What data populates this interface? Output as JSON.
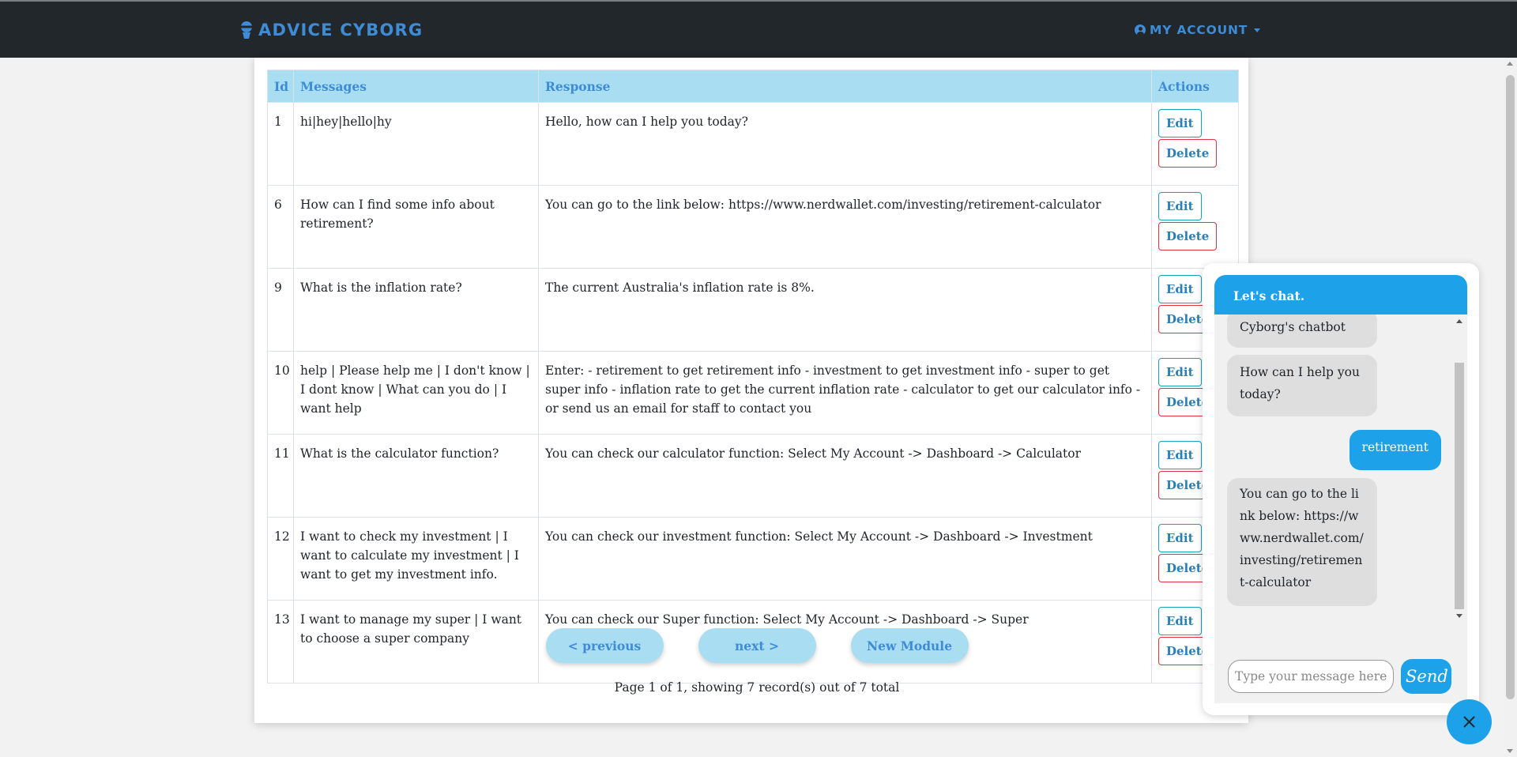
{
  "navbar": {
    "brand": "ADVICE CYBORG",
    "account_label": "MY ACCOUNT"
  },
  "table": {
    "headers": [
      "Id",
      "Messages",
      "Response",
      "Actions"
    ],
    "rows": [
      {
        "id": "1",
        "message": "hi|hey|hello|hy",
        "response": "Hello, how can I help you today?"
      },
      {
        "id": "6",
        "message": "How can I find some info about retirement?",
        "response": "You can go to the link below: https://www.nerdwallet.com/investing/retirement-calculator"
      },
      {
        "id": "9",
        "message": "What is the inflation rate?",
        "response": "The current Australia's inflation rate is 8%."
      },
      {
        "id": "10",
        "message": "help | Please help me | I don't know | I dont know | What can you do | I want help",
        "response": "Enter: - retirement to get retirement info - investment to get investment info - super to get super info - inflation rate to get the current inflation rate - calculator to get our calculator info - or send us an email for staff to contact you"
      },
      {
        "id": "11",
        "message": "What is the calculator function?",
        "response": "You can check our calculator function: Select My Account -> Dashboard -> Calculator"
      },
      {
        "id": "12",
        "message": "I want to check my investment | I want to calculate my investment | I want to get my investment info.",
        "response": "You can check our investment function: Select My Account -> Dashboard -> Investment"
      },
      {
        "id": "13",
        "message": "I want to manage my super | I want to choose a super company",
        "response": "You can check our Super function: Select My Account -> Dashboard -> Super"
      }
    ],
    "edit_label": "Edit",
    "delete_label": "Delete"
  },
  "pager": {
    "previous_label": "< previous",
    "next_label": "next >",
    "new_module_label": "New Module",
    "info": "Page 1 of 1, showing 7 record(s) out of 7 total"
  },
  "chat": {
    "header": "Let's chat.",
    "messages": [
      {
        "from": "bot",
        "text": "Cyborg's chatbot"
      },
      {
        "from": "bot",
        "text": "How can I help you today?"
      },
      {
        "from": "user",
        "text": "retirement"
      },
      {
        "from": "bot",
        "text": "You can go to the link below: https://www.nerdwallet.com/investing/retirement-calculator"
      }
    ],
    "input_placeholder": "Type your message here...",
    "send_label": "Send"
  },
  "colors": {
    "navbar_bg": "#22272c",
    "brand_blue": "#3e8bd6",
    "table_header_bg": "#a9def2",
    "chat_blue": "#1da1e8",
    "delete_border": "#dc3545",
    "edit_border": "#17a2b8"
  },
  "icons": {
    "brand": "robot-head-icon",
    "account": "user-circle-icon",
    "close": "close-icon"
  }
}
